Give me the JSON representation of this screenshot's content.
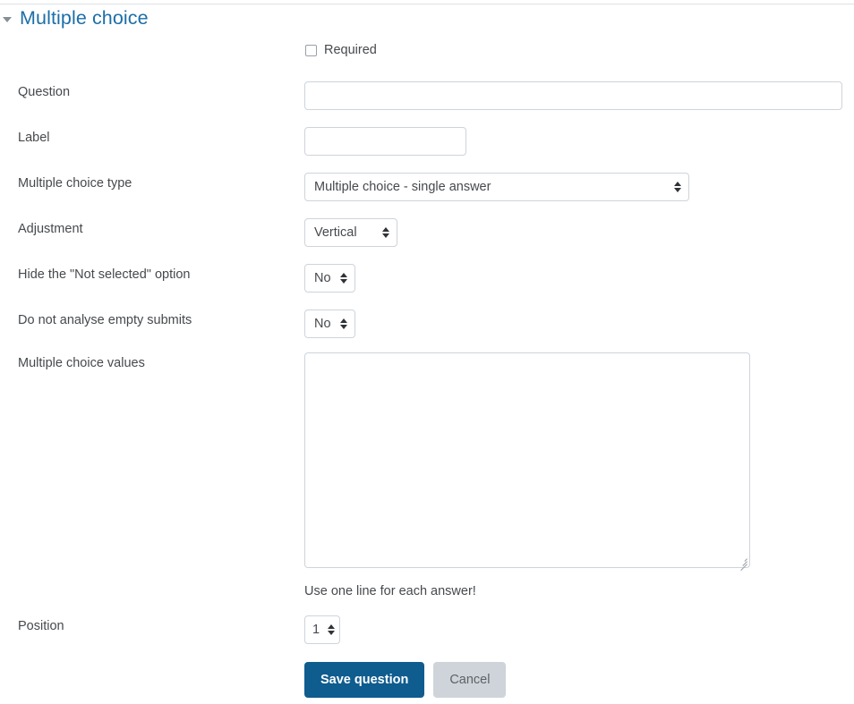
{
  "header": {
    "title": "Multiple choice",
    "collapse_icon": "triangle-down-icon",
    "accent_color": "#1c6ea8"
  },
  "required": {
    "label": "Required",
    "checked": false
  },
  "fields": {
    "question": {
      "label": "Question",
      "value": "",
      "placeholder": ""
    },
    "label": {
      "label": "Label",
      "value": "",
      "placeholder": ""
    },
    "multiple_choice_type": {
      "label": "Multiple choice type",
      "value": "Multiple choice - single answer"
    },
    "adjustment": {
      "label": "Adjustment",
      "value": "Vertical"
    },
    "hide_not_selected": {
      "label": "Hide the \"Not selected\" option",
      "value": "No"
    },
    "do_not_analyse_empty": {
      "label": "Do not analyse empty submits",
      "value": "No"
    },
    "multiple_choice_values": {
      "label": "Multiple choice values",
      "value": "",
      "hint": "Use one line for each answer!"
    },
    "position": {
      "label": "Position",
      "value": "1"
    }
  },
  "buttons": {
    "save": "Save question",
    "cancel": "Cancel",
    "save_color": "#0f5c8f",
    "cancel_color": "#ced4da"
  }
}
